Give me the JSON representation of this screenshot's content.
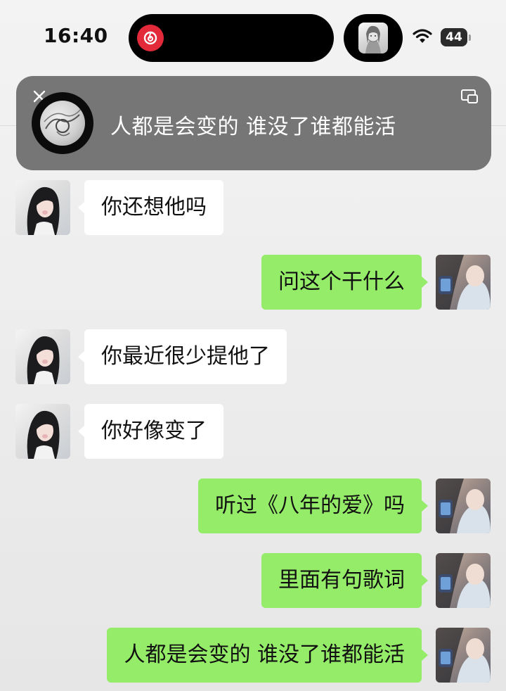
{
  "status_bar": {
    "time": "16:40",
    "battery": "44",
    "battery_level": 0.44,
    "island_app_icon": "netease-music-icon",
    "island_cover_icon": "album-cover-icon",
    "wifi_icon": "wifi-icon"
  },
  "music_banner": {
    "lyric": "人都是会变的 谁没了谁都能活",
    "close_icon": "close-icon",
    "pip_icon": "picture-in-picture-icon",
    "cover_icon": "vinyl-record-icon"
  },
  "chat": {
    "messages": [
      {
        "side": "incoming",
        "text": "你还想他吗"
      },
      {
        "side": "outgoing",
        "text": "问这个干什么"
      },
      {
        "side": "incoming",
        "text": "你最近很少提他了"
      },
      {
        "side": "incoming",
        "text": "你好像变了"
      },
      {
        "side": "outgoing",
        "text": "听过《八年的爱》吗"
      },
      {
        "side": "outgoing",
        "text": "里面有句歌词"
      },
      {
        "side": "outgoing",
        "text": "人都是会变的 谁没了谁都能活"
      }
    ]
  },
  "colors": {
    "outgoing_bubble": "#95ec69",
    "incoming_bubble": "#ffffff",
    "banner_background": "#707070",
    "island_app": "#e32a3b"
  }
}
